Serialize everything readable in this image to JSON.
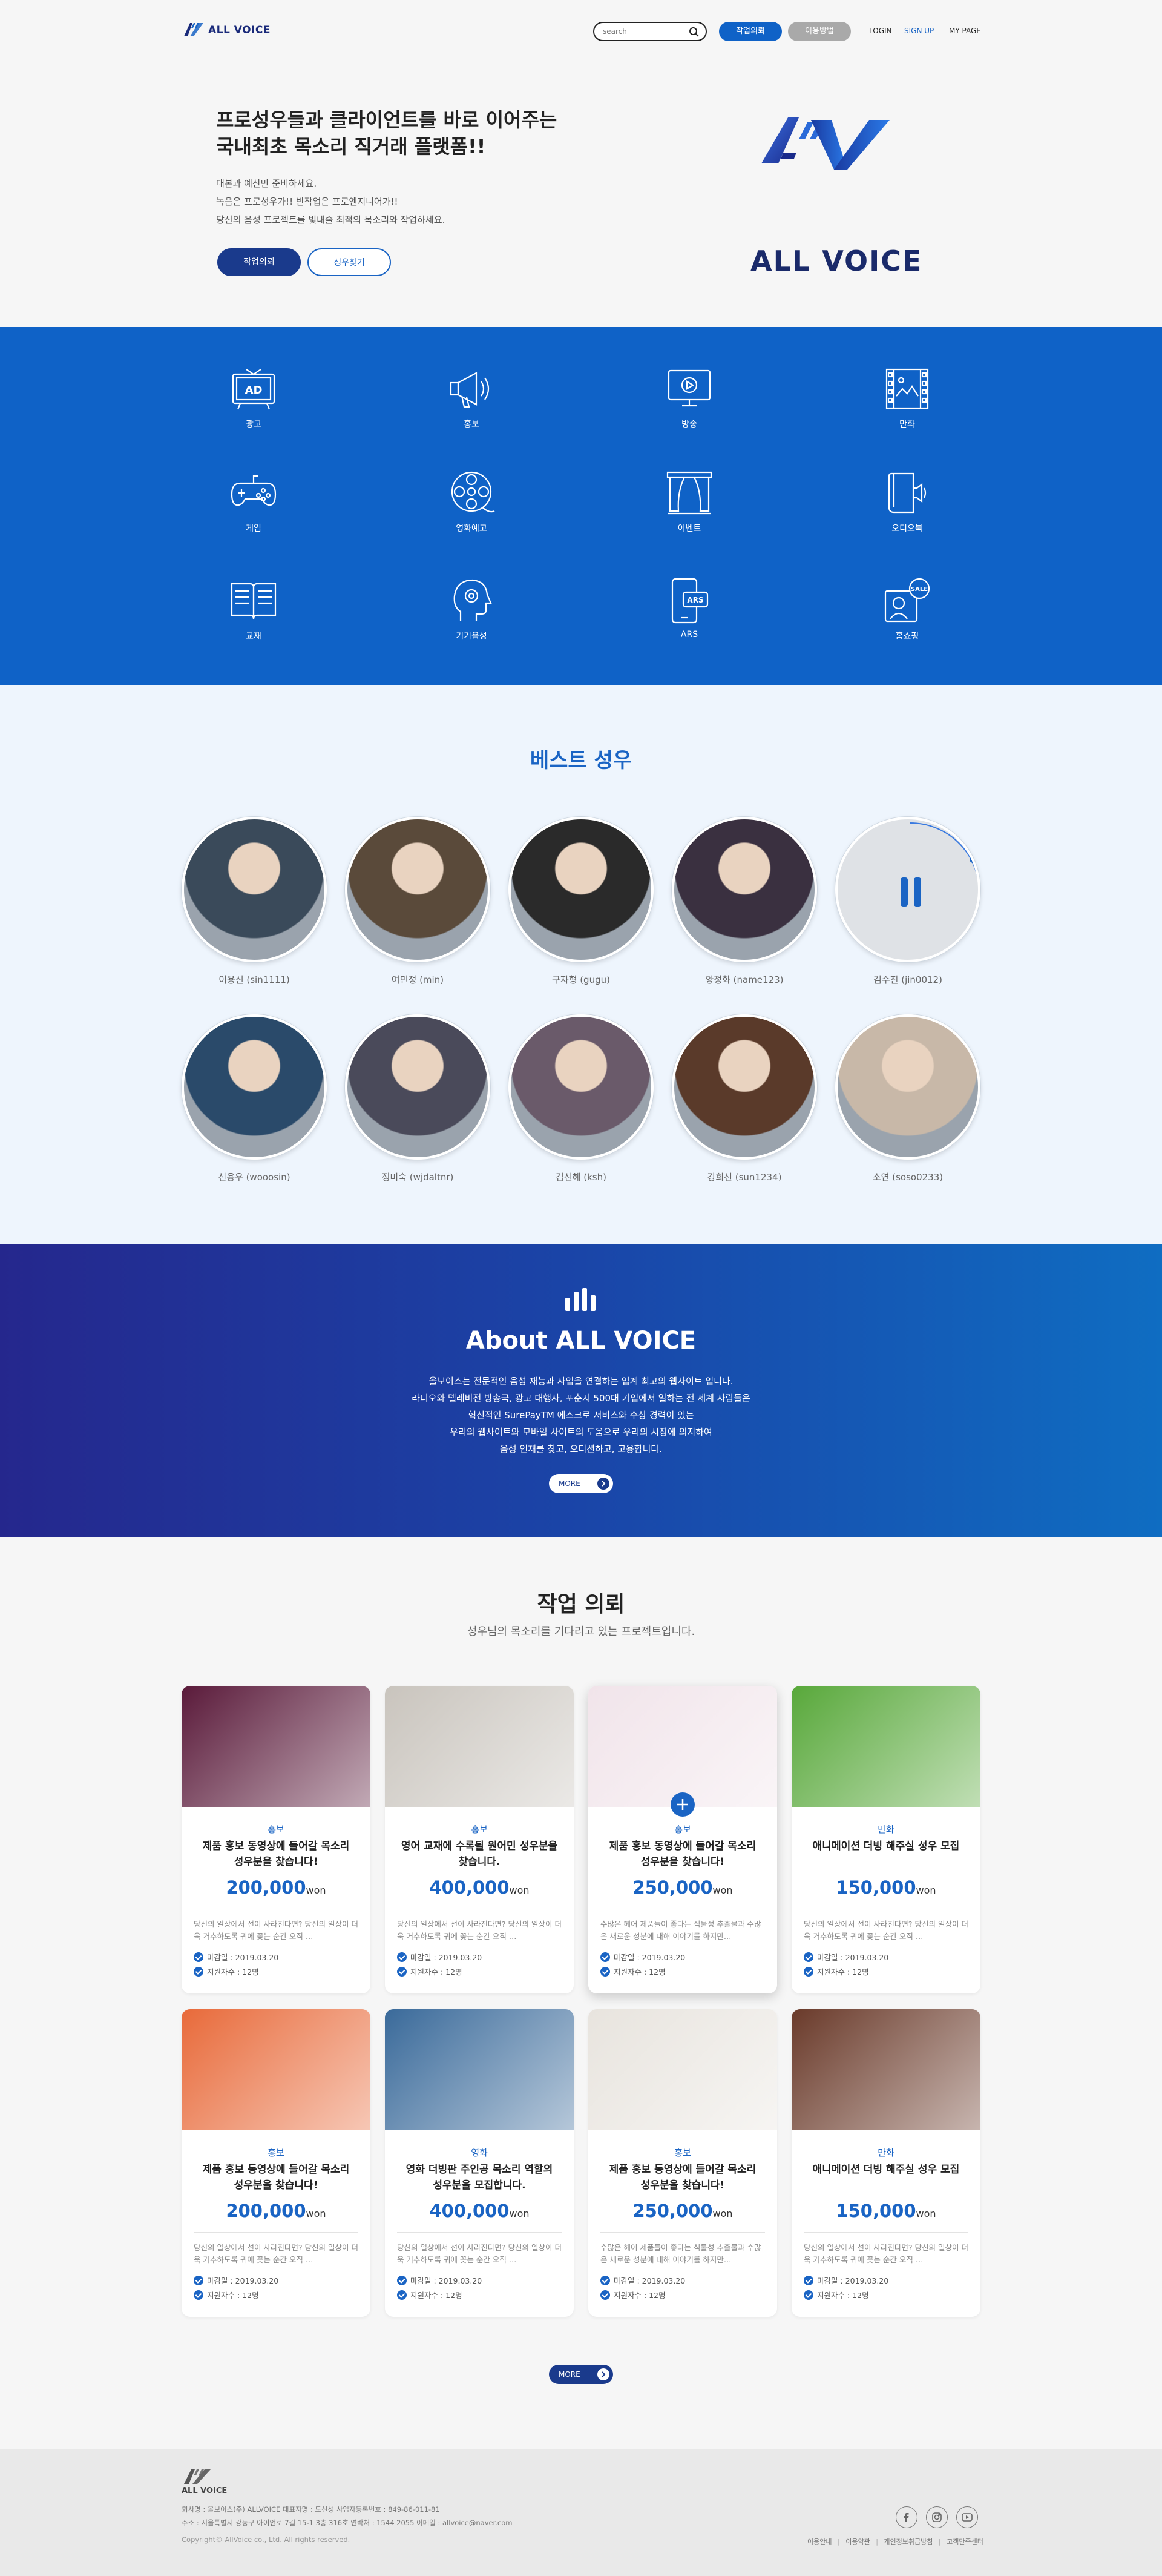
{
  "header": {
    "logo_text": "ALL VOICE",
    "search_placeholder": "search",
    "request_btn": "작업의뢰",
    "guide_btn": "이용방법",
    "login": "LOGIN",
    "signup": "SIGN UP",
    "mypage": "MY PAGE"
  },
  "hero": {
    "title_line1": "프로성우들과 클라이언트를 바로 이어주는",
    "title_line2": "국내최초 목소리 직거래 플랫폼!!",
    "desc_line1": "대본과 예산만 준비하세요.",
    "desc_line2": "녹음은 프로성우가!! 반작업은 프로엔지니어가!!",
    "desc_line3": "당신의 음성 프로젝트를 빛내줄 최적의 목소리와 작업하세요.",
    "btn_request": "작업의뢰",
    "btn_find": "성우찾기",
    "brand_text": "ALL VOICE",
    "brand_mark": "AV"
  },
  "categories": [
    {
      "label": "광고",
      "icon": "tv-ad-icon"
    },
    {
      "label": "홍보",
      "icon": "megaphone-icon"
    },
    {
      "label": "방송",
      "icon": "broadcast-icon"
    },
    {
      "label": "만화",
      "icon": "film-icon"
    },
    {
      "label": "게임",
      "icon": "gamepad-icon"
    },
    {
      "label": "영화예고",
      "icon": "film-reel-icon"
    },
    {
      "label": "이벤트",
      "icon": "stage-curtain-icon"
    },
    {
      "label": "오디오북",
      "icon": "audiobook-icon"
    },
    {
      "label": "교재",
      "icon": "book-icon"
    },
    {
      "label": "기기음성",
      "icon": "head-voice-icon"
    },
    {
      "label": "ARS",
      "icon": "phone-ars-icon"
    },
    {
      "label": "홈쇼핑",
      "icon": "home-shopping-icon"
    }
  ],
  "best": {
    "title": "베스트 성우",
    "actors": [
      {
        "name": "이용신 (sin1111)",
        "color": "#3a4a5a"
      },
      {
        "name": "여민정 (min)",
        "color": "#5a4a3a"
      },
      {
        "name": "구자형 (gugu)",
        "color": "#2a2a2a"
      },
      {
        "name": "양정화 (name123)",
        "color": "#3a3040"
      },
      {
        "name": "김수진 (jin0012)",
        "color": "#d8dadd"
      },
      {
        "name": "신용우 (wooosin)",
        "color": "#2a4a6a"
      },
      {
        "name": "정미숙 (wjdaltnr)",
        "color": "#4a4a5a"
      },
      {
        "name": "김선혜 (ksh)",
        "color": "#6a5a6a"
      },
      {
        "name": "강희선 (sun1234)",
        "color": "#5a3a2a"
      },
      {
        "name": "소연 (soso0233)",
        "color": "#c8b8a8"
      }
    ]
  },
  "about": {
    "title": "About ALL VOICE",
    "line1": "올보이스는 전문적인 음성 재능과 사업을 연결하는 업계 최고의 웹사이트 입니다.",
    "line2": "라디오와 텔레비전 방송국, 광고 대행사, 포춘지 500대 기업에서 일하는 전 세계 사람들은",
    "line3": "혁신적인 SurePayTM 에스크로 서비스와 수상 경력이 있는",
    "line4": "우리의 웹사이트와 모바일 사이트의 도움으로 우리의 시장에 의지하여",
    "line5": "음성 인재를 찾고, 오디션하고, 고용합니다.",
    "more": "MORE"
  },
  "jobs": {
    "title": "작업 의뢰",
    "subtitle": "성우님의 목소리를 기다리고 있는 프로젝트입니다.",
    "more": "MORE",
    "cards": [
      {
        "category": "홍보",
        "title": "제품 홍보 동영상에 들어갈 목소리 성우분을 찾습니다!",
        "price": "200,000",
        "unit": "won",
        "desc": "당신의 일상에서 선이 사라진다면? 당신의 일상이 더욱 거추하도록 귀에 꽂는 순간 오직 …",
        "deadline": "마감일 : 2019.03.20",
        "applicants": "지원자수 : 12명",
        "bg": "#5a1a3a"
      },
      {
        "category": "홍보",
        "title": "영어 교재에 수록될 원어민 성우분을 찾습니다.",
        "price": "400,000",
        "unit": "won",
        "desc": "당신의 일상에서 선이 사라진다면? 당신의 일상이 더욱 거추하도록 귀에 꽂는 순간 오직 …",
        "deadline": "마감일 : 2019.03.20",
        "applicants": "지원자수 : 12명",
        "bg": "#c9c4bd"
      },
      {
        "category": "홍보",
        "title": "제품 홍보 동영상에 들어갈 목소리 성우분을 찾습니다!",
        "price": "250,000",
        "unit": "won",
        "desc": "수많은 헤어 제품들이 좋다는 식물성 추출물과 수많은 새로운 성분에 대해 이야기를 하지만…",
        "deadline": "마감일 : 2019.03.20",
        "applicants": "지원자수 : 12명",
        "bg": "#f1e4ea"
      },
      {
        "category": "만화",
        "title": "애니메이션 더빙 해주실 성우 모집",
        "price": "150,000",
        "unit": "won",
        "desc": "당신의 일상에서 선이 사라진다면? 당신의 일상이 더욱 거추하도록 귀에 꽂는 순간 오직 …",
        "deadline": "마감일 : 2019.03.20",
        "applicants": "지원자수 : 12명",
        "bg": "#58a83a"
      },
      {
        "category": "홍보",
        "title": "제품 홍보 동영상에 들어갈 목소리 성우분을 찾습니다!",
        "price": "200,000",
        "unit": "won",
        "desc": "당신의 일상에서 선이 사라진다면? 당신의 일상이 더욱 거추하도록 귀에 꽂는 순간 오직 …",
        "deadline": "마감일 : 2019.03.20",
        "applicants": "지원자수 : 12명",
        "bg": "#e86a3a"
      },
      {
        "category": "영화",
        "title": "영화 더빙판 주인공 목소리 역할의 성우분을 모집합니다.",
        "price": "400,000",
        "unit": "won",
        "desc": "당신의 일상에서 선이 사라진다면? 당신의 일상이 더욱 거추하도록 귀에 꽂는 순간 오직 …",
        "deadline": "마감일 : 2019.03.20",
        "applicants": "지원자수 : 12명",
        "bg": "#3a6a9a"
      },
      {
        "category": "홍보",
        "title": "제품 홍보 동영상에 들어갈 목소리 성우분을 찾습니다!",
        "price": "250,000",
        "unit": "won",
        "desc": "수많은 헤어 제품들이 좋다는 식물성 추출물과 수많은 새로운 성분에 대해 이야기를 하지만…",
        "deadline": "마감일 : 2019.03.20",
        "applicants": "지원자수 : 12명",
        "bg": "#e8e4de"
      },
      {
        "category": "만화",
        "title": "애니메이션 더빙 해주실 성우 모집",
        "price": "150,000",
        "unit": "won",
        "desc": "당신의 일상에서 선이 사라진다면? 당신의 일상이 더욱 거추하도록 귀에 꽂는 순간 오직 …",
        "deadline": "마감일 : 2019.03.20",
        "applicants": "지원자수 : 12명",
        "bg": "#6a3a2a"
      }
    ]
  },
  "footer": {
    "logo_text": "ALL VOICE",
    "line1": "회사명 : 올보이스(주) ALLVOICE 대표자명 : 도신성 사업자등록번호 : 849-86-011-81",
    "line2": "주소 : 서울특별시 강동구 아이언로 7길 15-1 3층 316호 연락처 : 1544 2055 이메일 : allvoice@naver.com",
    "copyright": "Copyright© AllVoice co., Ltd. All rights reserved.",
    "links": [
      "이용안내",
      "이용약관",
      "개인정보취급방침",
      "고객만족센터"
    ]
  },
  "colors": {
    "primary": "#0f62c7",
    "dark_blue": "#1a3a8c",
    "accent": "#1a64c4"
  }
}
